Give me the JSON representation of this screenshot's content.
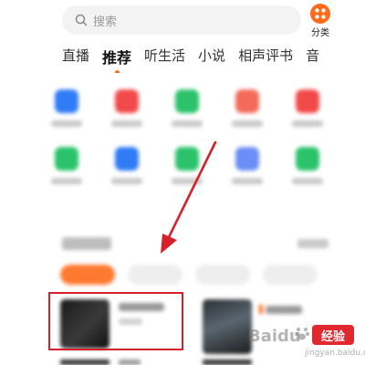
{
  "search": {
    "placeholder": "搜索"
  },
  "category": {
    "label": "分类",
    "icon": "category-grid-icon",
    "color": "#ff6a1a"
  },
  "tabs": [
    {
      "label": "直播"
    },
    {
      "label": "推荐",
      "active": true
    },
    {
      "label": "听生活"
    },
    {
      "label": "小说"
    },
    {
      "label": "相声评书"
    },
    {
      "label": "音"
    }
  ],
  "icon_grid": {
    "row1": [
      "#2f7cf6",
      "#f24a4a",
      "#2cc26b",
      "#f26b5a",
      "#f24a4a"
    ],
    "row2": [
      "#2cc26b",
      "#2f7cf6",
      "#2cc26b",
      "#6a8ef6",
      "#2cc26b"
    ]
  },
  "accent": "#ff6a1a",
  "highlight_color": "#d8202a",
  "watermark": {
    "text": "Baidu",
    "badge": "经验",
    "url": "jingyan.baidu.com"
  }
}
